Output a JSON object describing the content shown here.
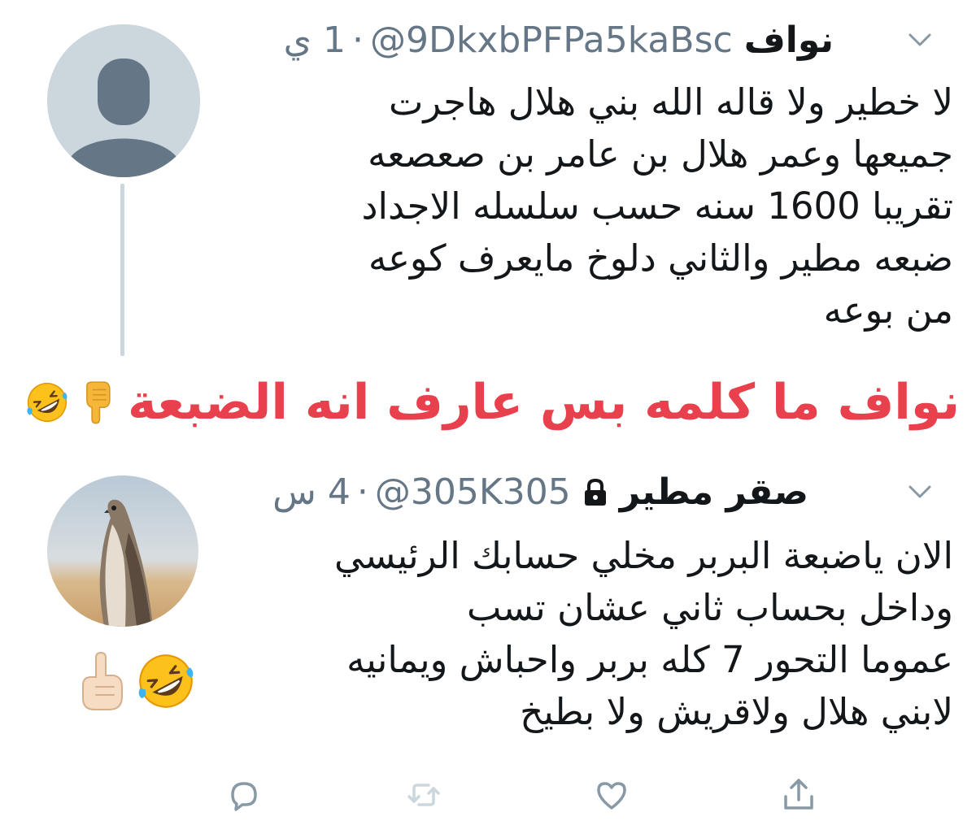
{
  "tweet1": {
    "display_name": "نواف",
    "handle": "@9DkxbPFPa5kaBsc",
    "separator": "·",
    "time": "1 ي",
    "lines": [
      "لا خطير ولا قاله الله بني هلال هاجرت",
      "جميعها وعمر هلال بن عامر بن صعصعه",
      "تقريبا 1600 سنه حسب سلسله الاجداد",
      "ضبعه مطير والثاني دلوخ مايعرف كوعه",
      "من بوعه"
    ]
  },
  "caption": {
    "text": "نواف ما كلمه بس عارف انه الضبعة",
    "color": "#e8404c",
    "emojis": [
      "pointing-down-hand-emoji",
      "rolling-laughing-face-emoji"
    ]
  },
  "tweet2": {
    "display_name": "صقر مطير",
    "handle": "@305K305",
    "separator": "·",
    "time": "4 س",
    "lines": [
      "الان ياضبعة البربر مخلي حسابك الرئيسي",
      "وداخل بحساب ثاني عشان تسب",
      "عموما التحور 7 كله بربر واحباش ويمانيه",
      "لابني هلال ولاقريش ولا بطيخ"
    ],
    "emojis": [
      "pointing-up-hand-emoji",
      "rolling-laughing-face-emoji"
    ]
  },
  "actions": [
    "reply-icon",
    "retweet-icon",
    "like-icon",
    "share-icon"
  ],
  "colors": {
    "text": "#14171a",
    "secondary": "#657786",
    "icon": "#8899a6",
    "thread_line": "#ccd6dd"
  }
}
